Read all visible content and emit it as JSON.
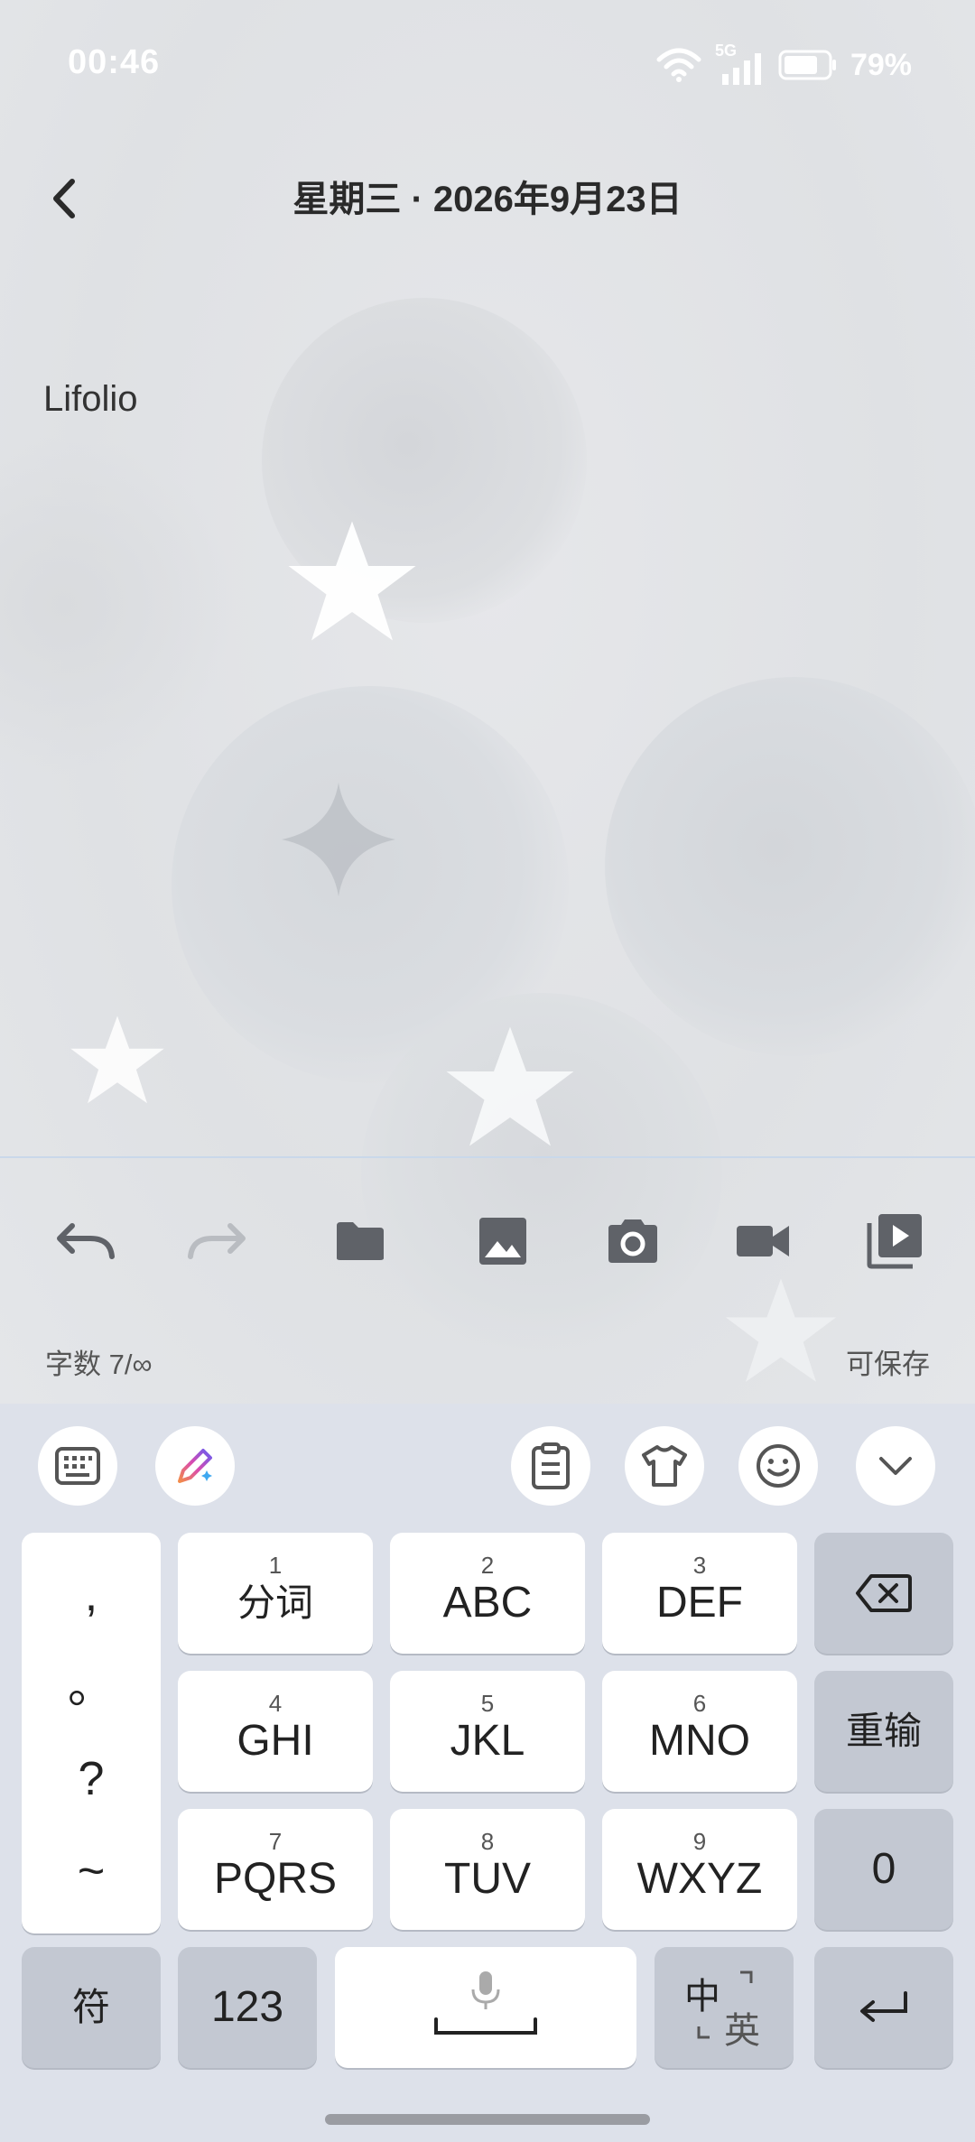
{
  "status_bar": {
    "time": "00:46",
    "network": "5G",
    "battery": "79%"
  },
  "header": {
    "title": "星期三 · 2026年9月23日"
  },
  "editor": {
    "content": "Lifolio"
  },
  "toolbar": {
    "icons": [
      "undo-icon",
      "redo-icon",
      "folder-icon",
      "image-icon",
      "camera-icon",
      "video-icon",
      "video-library-icon"
    ],
    "word_count": "字数 7/∞",
    "save_status": "可保存"
  },
  "keyboard": {
    "toolbar_icons": [
      "keyboard-icon",
      "ai-pen-icon",
      "clipboard-icon",
      "skin-icon",
      "emoji-icon",
      "collapse-icon"
    ],
    "punct": [
      ",",
      "。",
      "?",
      "~"
    ],
    "keys": [
      {
        "num": "1",
        "label": "分词"
      },
      {
        "num": "2",
        "label": "ABC"
      },
      {
        "num": "3",
        "label": "DEF"
      },
      {
        "num": "4",
        "label": "GHI"
      },
      {
        "num": "5",
        "label": "JKL"
      },
      {
        "num": "6",
        "label": "MNO"
      },
      {
        "num": "7",
        "label": "PQRS"
      },
      {
        "num": "8",
        "label": "TUV"
      },
      {
        "num": "9",
        "label": "WXYZ"
      }
    ],
    "reinput": "重输",
    "zero": "0",
    "symbol": "符",
    "numeric": "123",
    "lang_primary": "中",
    "lang_secondary": "英"
  },
  "colors": {
    "keyboard_bg": "#dde1ea",
    "key_white": "#ffffff",
    "key_dark": "#c3c8d2",
    "divider": "#c9d8ea"
  }
}
